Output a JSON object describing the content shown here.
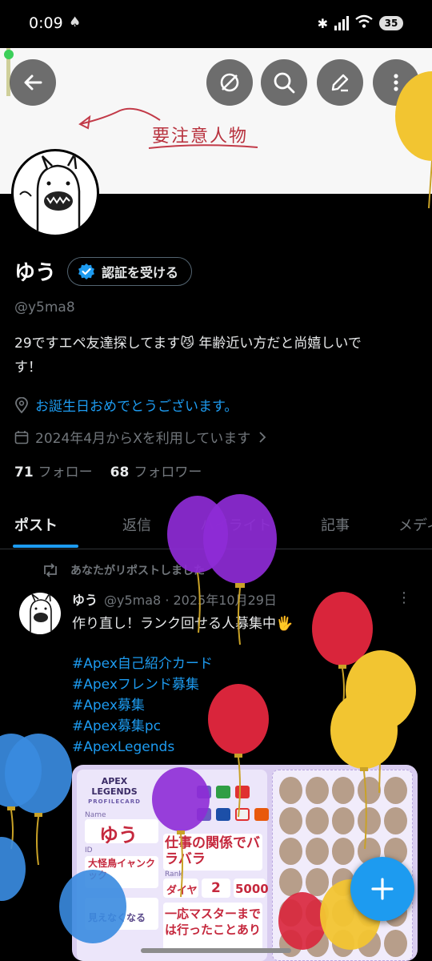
{
  "status_bar": {
    "time": "0:09",
    "battery": "35"
  },
  "banner": {
    "note_text": "要注意人物"
  },
  "profile": {
    "name": "ゆう",
    "verify_label": "認証を受ける",
    "handle": "@y5ma8",
    "bio_line1": "29ですエペ友達探してます😼 年齢近い方だと尚嬉しいで",
    "bio_line2": "す！",
    "location": "お誕生日おめでとうございます。",
    "joined": "2024年4月からXを利用しています",
    "following_count": "71",
    "following_label": "フォロー",
    "followers_count": "68",
    "followers_label": "フォロワー"
  },
  "tabs": [
    {
      "label": "ポスト"
    },
    {
      "label": "返信"
    },
    {
      "label": "ハイライト"
    },
    {
      "label": "記事"
    },
    {
      "label": "メディ"
    }
  ],
  "post": {
    "repost_text": "あなたがリポストしました",
    "author": "ゆう",
    "meta": "@y5ma8 · 2025年10月29日",
    "text": "作り直し！ランク回せる人募集中🖐",
    "hashtags": [
      "#Apex自己紹介カード",
      "#Apexフレンド募集",
      "#Apex募集",
      "#Apex募集pc",
      "#ApexLegends"
    ]
  },
  "card": {
    "logo_line1": "APEX",
    "logo_line2": "LEGENDS",
    "logo_sub": "PROFILECARD",
    "name_label": "Name",
    "name_value": "ゆう",
    "id_label": "ID",
    "id_value": "大怪鳥イャンクック",
    "comment_value": "仕事の関係でバラバラ",
    "rank_label": "Rank",
    "rank_value": "ダイヤ",
    "level_value": "2",
    "kills_value": "5000",
    "note_value": "一応マスターまでは行ったことあり",
    "misc_value": "見えなくなる"
  },
  "colors": {
    "accent": "#1d9bf0",
    "background": "#000000",
    "muted": "#71767b",
    "balloon_purple": "#8e2bd6",
    "balloon_red": "#d9253b",
    "balloon_yellow": "#f2c531",
    "balloon_blue": "#3a8be0"
  },
  "icons": [
    "back-arrow-icon",
    "hide-icon",
    "search-icon",
    "edit-icon",
    "more-vertical-icon",
    "verified-badge-icon",
    "location-icon",
    "calendar-icon",
    "chevron-right-icon",
    "repost-icon",
    "compose-plus-icon"
  ]
}
